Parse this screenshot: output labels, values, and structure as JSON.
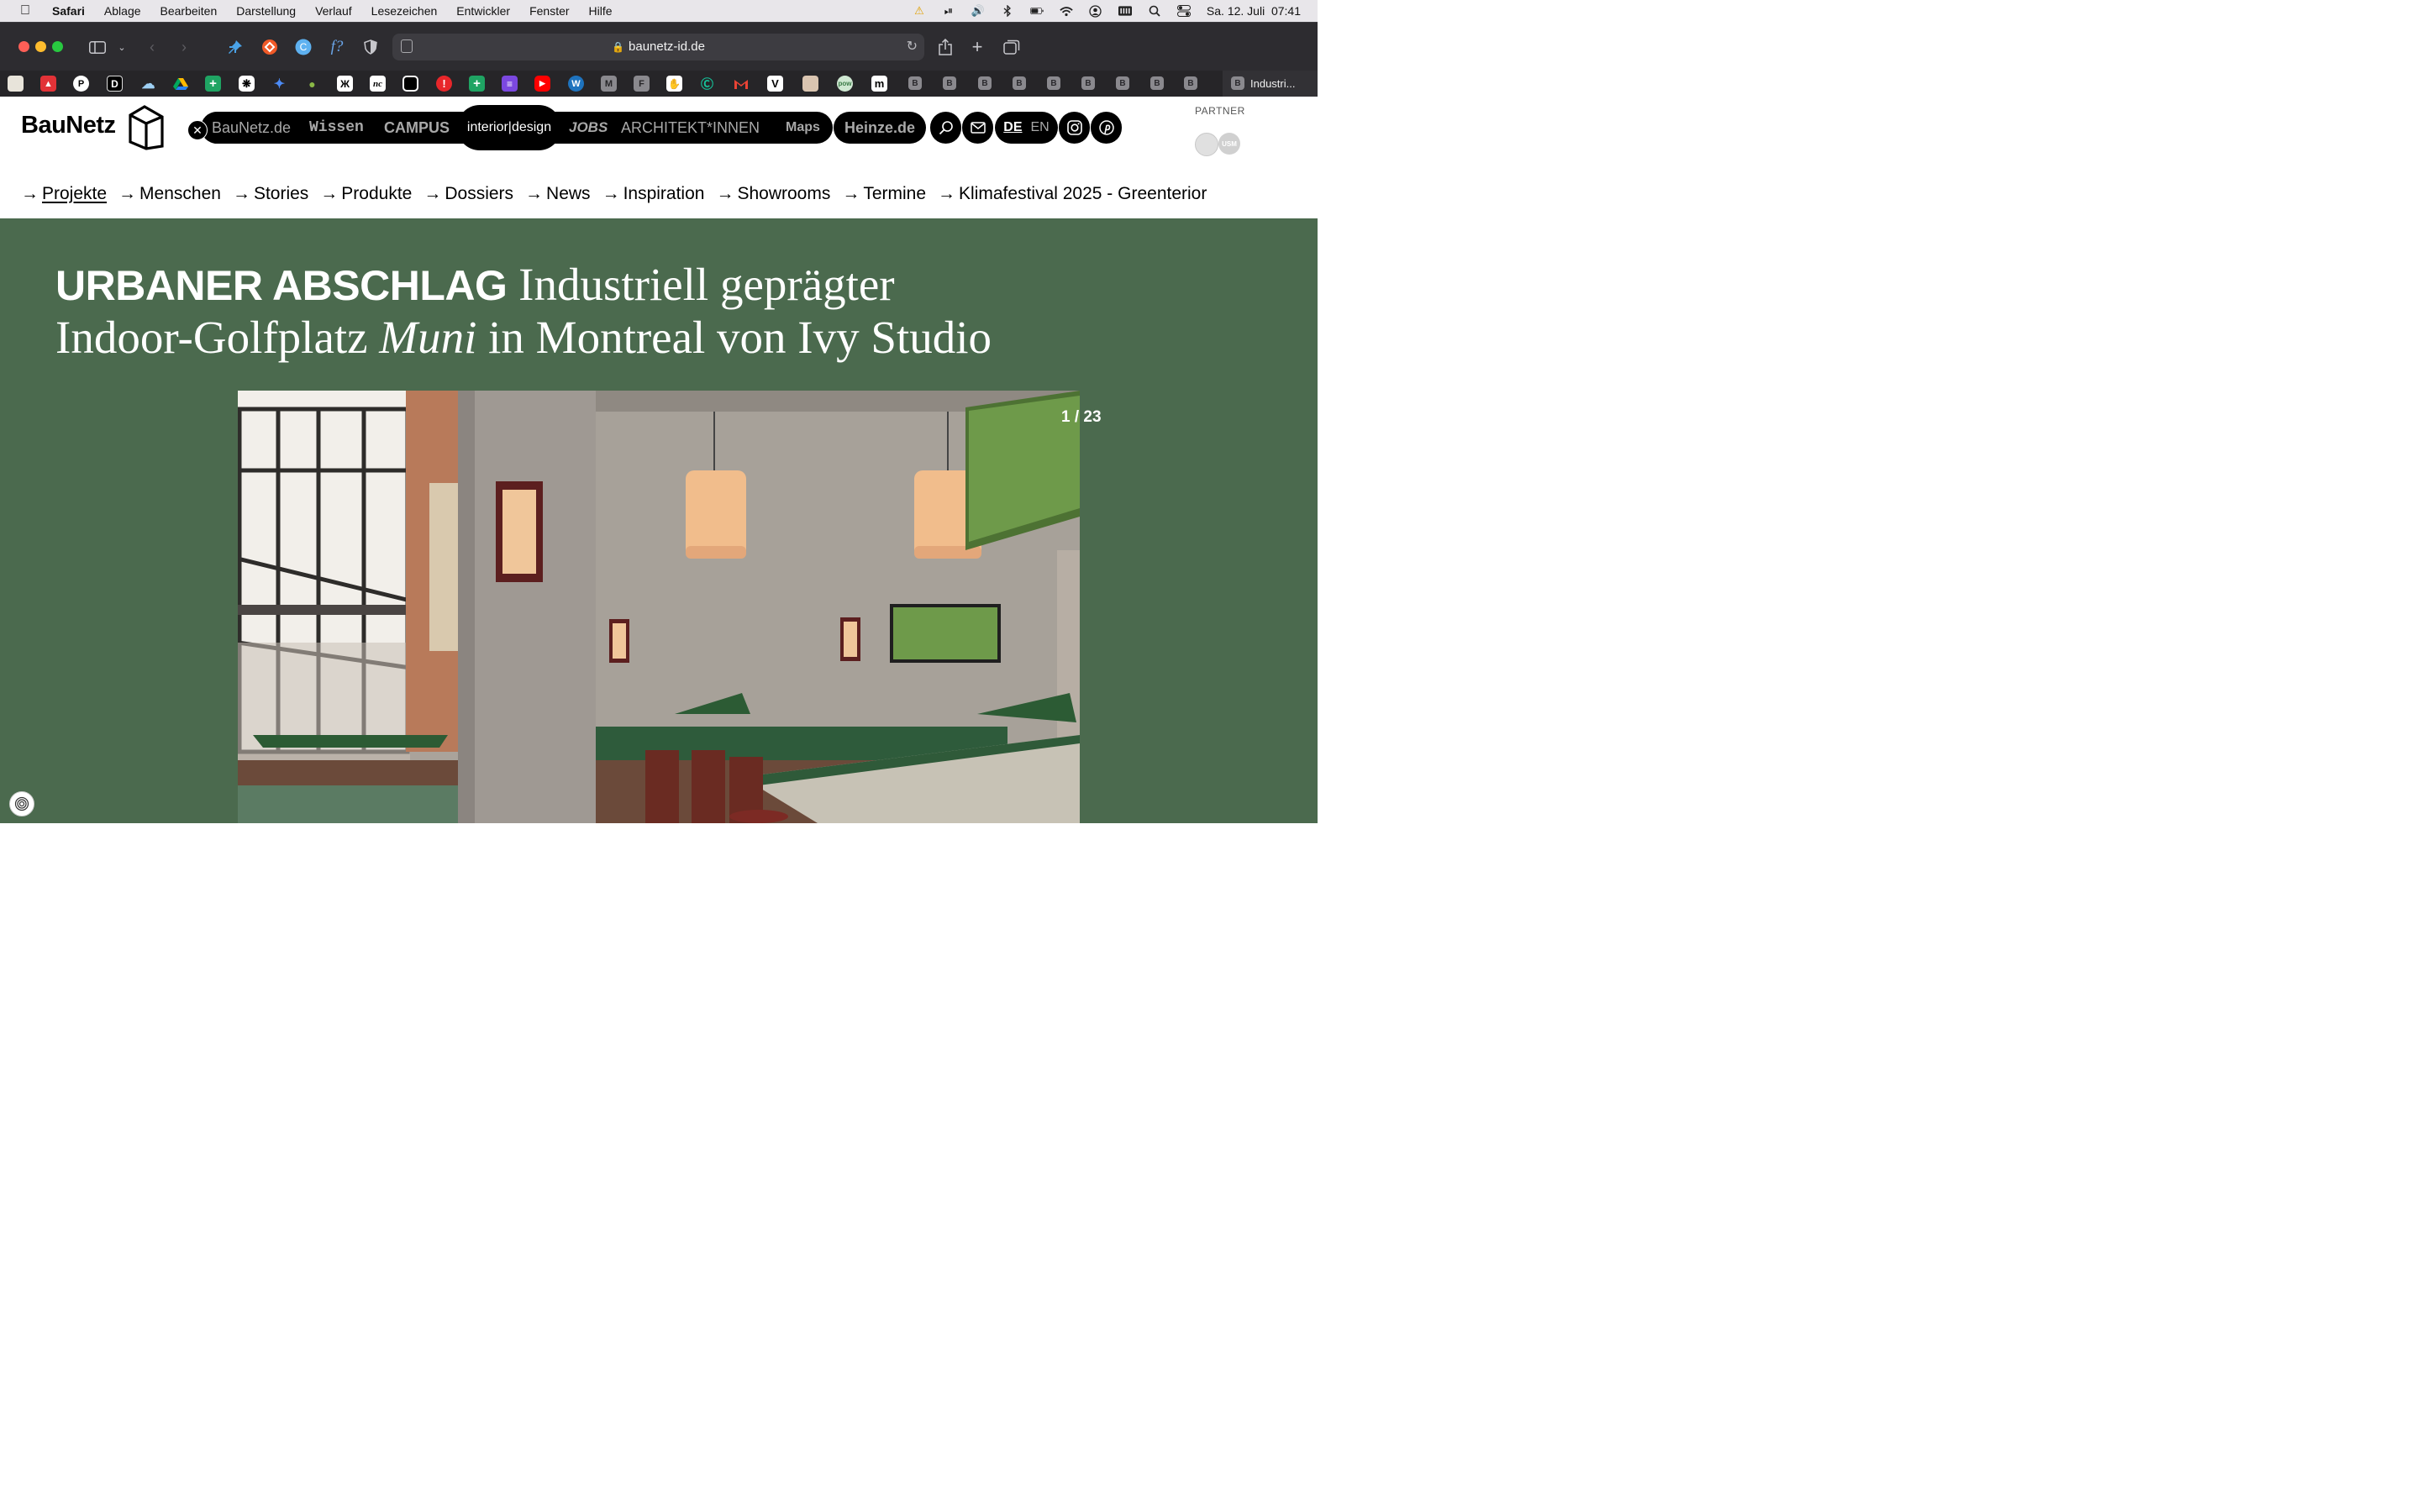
{
  "menubar": {
    "app": "Safari",
    "items": [
      "Ablage",
      "Bearbeiten",
      "Darstellung",
      "Verlauf",
      "Lesezeichen",
      "Entwickler",
      "Fenster",
      "Hilfe"
    ],
    "datetime": "Sa. 12. Juli  07:41"
  },
  "browser": {
    "url": "baunetz-id.de",
    "active_tab_label": "Industri...",
    "bookmark_tab_letter": "B"
  },
  "site": {
    "logo": "BauNetz",
    "portal": {
      "baunetz": "BauNetz.de",
      "wissen": "Wissen",
      "campus": "CAMPUS",
      "interior": "interior|design",
      "jobs": "JOBS",
      "architekten": "ARCHITEKT*INNEN",
      "maps": "Maps",
      "heinze": "Heinze.de"
    },
    "lang": {
      "de": "DE",
      "en": "EN"
    },
    "partner_label": "PARTNER",
    "partner_logo_text": "USM",
    "subnav": [
      {
        "label": "Projekte",
        "active": true
      },
      {
        "label": "Menschen"
      },
      {
        "label": "Stories"
      },
      {
        "label": "Produkte"
      },
      {
        "label": "Dossiers"
      },
      {
        "label": "News"
      },
      {
        "label": "Inspiration"
      },
      {
        "label": "Showrooms"
      },
      {
        "label": "Termine"
      },
      {
        "label": "Klimafestival 2025 - Greenterior"
      }
    ],
    "subnav_arrow": "→"
  },
  "article": {
    "kicker": "URBANER ABSCHLAG",
    "title_part1": "Industriell geprägter Indoor-Golfplatz",
    "title_italic": "Muni",
    "title_part2": "in Montreal von Ivy Studio",
    "gallery_counter": "1 / 23"
  },
  "colors": {
    "hero_bg": "#4b6a4e",
    "chrome_bg": "#2d2c30",
    "menubar_bg": "#e8e6ea"
  }
}
